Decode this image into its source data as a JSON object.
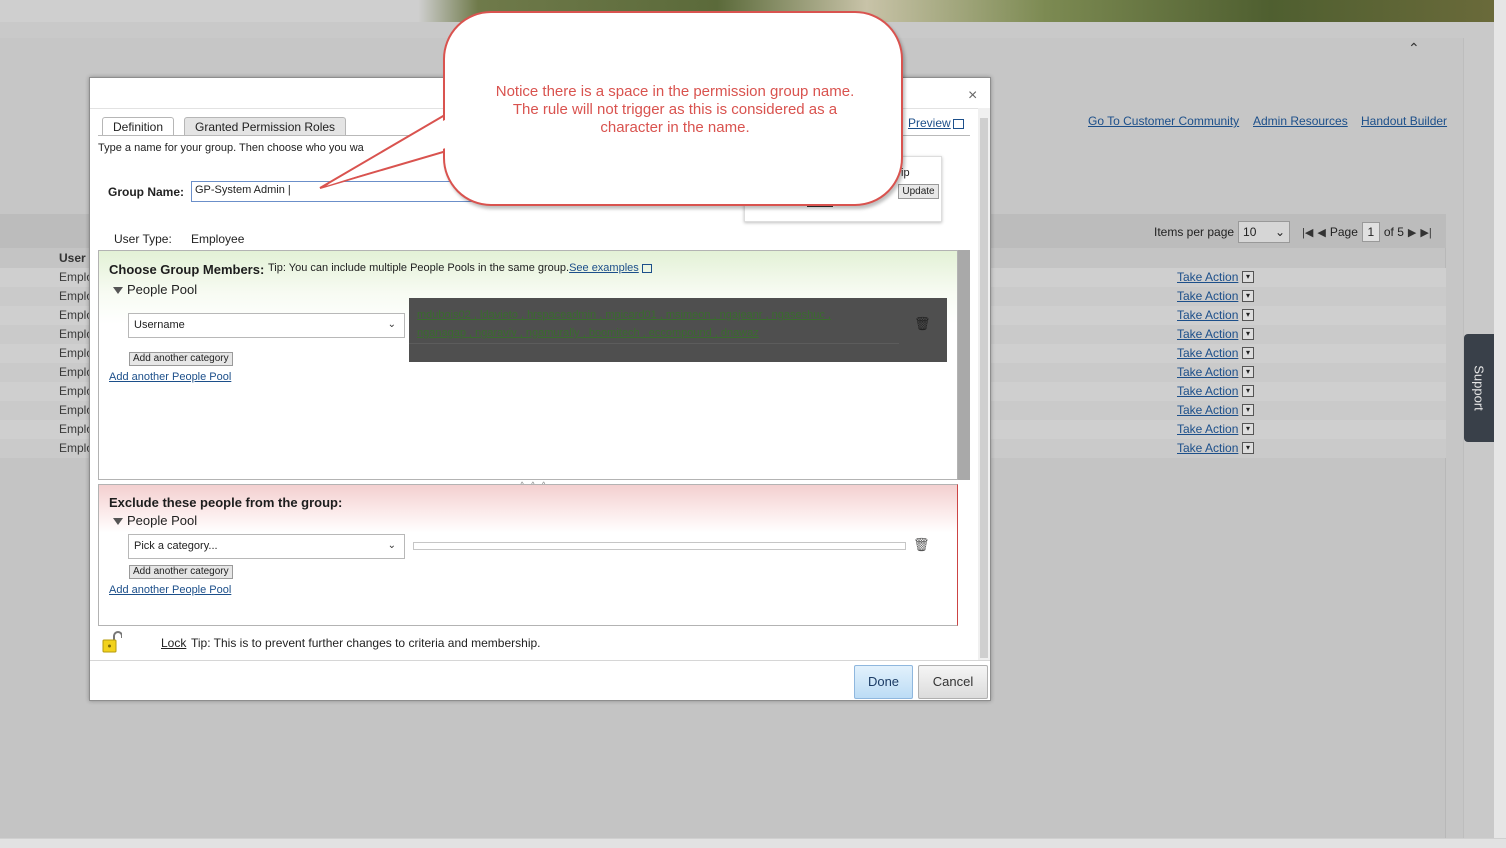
{
  "header": {
    "links": [
      "Go To Customer Community",
      "Admin Resources",
      "Handout Builder"
    ]
  },
  "list": {
    "col_user": "User",
    "rows": [
      {
        "type": "Emplo",
        "action": "Take Action"
      },
      {
        "type": "Emplo",
        "action": "Take Action"
      },
      {
        "type": "Emplo",
        "action": "Take Action"
      },
      {
        "type": "Emplo",
        "action": "Take Action"
      },
      {
        "type": "Emplo",
        "action": "Take Action"
      },
      {
        "type": "Emplo",
        "action": "Take Action"
      },
      {
        "type": "Emplo",
        "action": "Take Action"
      },
      {
        "type": "Emplo",
        "action": "Take Action"
      },
      {
        "type": "Emplo",
        "action": "Take Action"
      },
      {
        "type": "Emplo",
        "action": "Take Action"
      }
    ],
    "items_per_page_label": "Items per page",
    "items_per_page": "10",
    "page_label": "Page",
    "page_current": "1",
    "page_of": "of 5"
  },
  "support": {
    "label": "Support"
  },
  "dialog": {
    "close": "×",
    "tabs": [
      "Definition",
      "Granted Permission Roles"
    ],
    "preview_label": "Preview",
    "intro": "Type a name for your group. Then choose who you wa",
    "group_name_label": "Group Name:",
    "group_name_value": "GP-System Admin |",
    "membership_ip": "ip",
    "update_label": "Update",
    "user_type_label": "User Type:",
    "user_type_value": "Employee",
    "include": {
      "title": "Choose Group Members:",
      "tip": "Tip: You can include multiple People Pools in the same group.",
      "see_examples": "See examples",
      "pool_label": "People Pool",
      "category": "Username",
      "add_category": "Add another category",
      "add_pool": "Add another People Pool",
      "users_line1": "mdubois02 , ldavieto , hrspaceadmin , mpicard01 , msimeon , ngajeanr , ngaseshuc ,",
      "users_line2": "nganagap , ngaraviv , ngamurally , boomitech , eccompound , dnawaz"
    },
    "exclude": {
      "title": "Exclude these people from the group:",
      "pool_label": "People Pool",
      "category": "Pick a category...",
      "add_category": "Add another category",
      "add_pool": "Add another People Pool"
    },
    "lock_label": "Lock",
    "lock_tip": "Tip: This is to prevent further changes to criteria and membership.",
    "done_label": "Done",
    "cancel_label": "Cancel"
  },
  "callout": {
    "line1": "Notice there is a space in the permission group name.",
    "line2": "The rule will not trigger as this is considered as a",
    "line3": "character in the name.",
    "color": "#d9534f"
  }
}
